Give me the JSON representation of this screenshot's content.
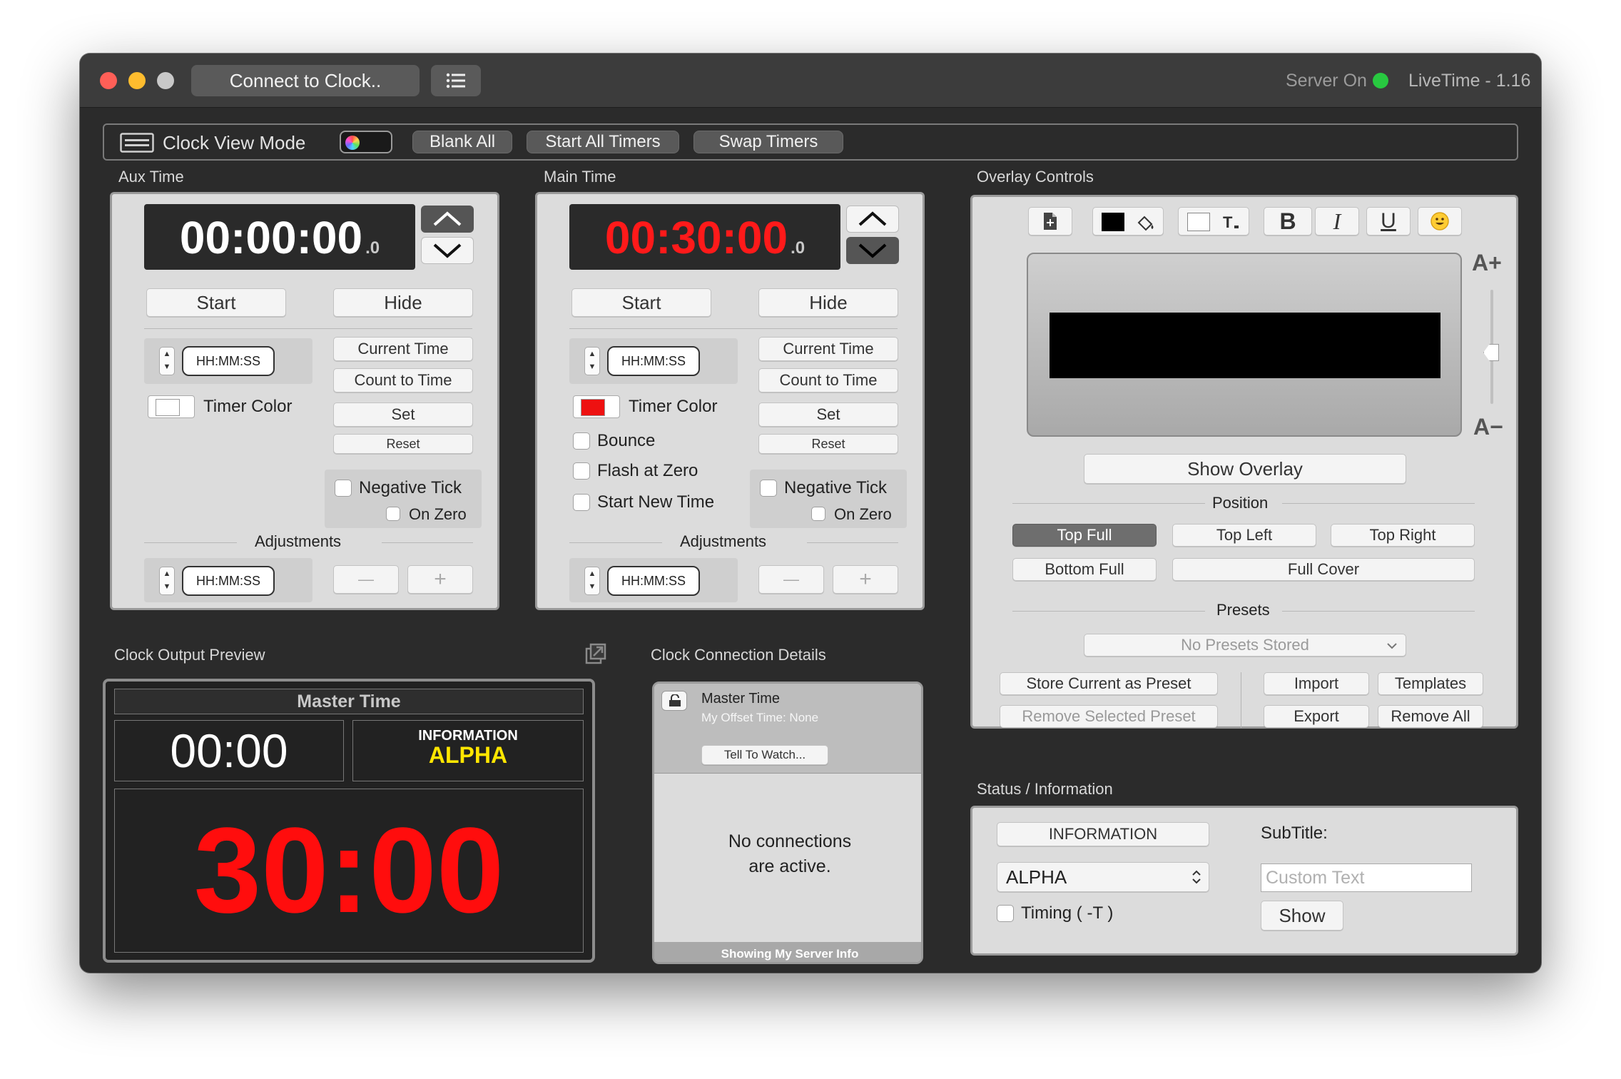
{
  "titlebar": {
    "connect_button": "Connect to Clock..",
    "server_status": "Server On",
    "app_version": "LiveTime - 1.16",
    "server_status_color": "#28c840"
  },
  "toolbar": {
    "clock_view_mode": "Clock View Mode",
    "blank_all": "Blank All",
    "start_all_timers": "Start All Timers",
    "swap_timers": "Swap Timers"
  },
  "aux": {
    "section_label": "Aux Time",
    "time": "00:00:00",
    "tenths": ".0",
    "time_color": "#ffffff",
    "start": "Start",
    "hide": "Hide",
    "hms_placeholder": "HH:MM:SS",
    "current_time": "Current Time",
    "count_to_time": "Count to Time",
    "timer_color_label": "Timer Color",
    "timer_color_swatch": "#ffffff",
    "set": "Set",
    "reset": "Reset",
    "negative_tick": "Negative Tick",
    "on_zero": "On Zero",
    "adjustments": "Adjustments",
    "adj_placeholder": "HH:MM:SS",
    "minus": "—",
    "plus": "+"
  },
  "main": {
    "section_label": "Main Time",
    "time": "00:30:00",
    "tenths": ".0",
    "time_color": "#ff1a1a",
    "start": "Start",
    "hide": "Hide",
    "hms_placeholder": "HH:MM:SS",
    "current_time": "Current Time",
    "count_to_time": "Count to Time",
    "timer_color_label": "Timer Color",
    "timer_color_swatch": "#ee1111",
    "bounce": "Bounce",
    "flash_at_zero": "Flash at Zero",
    "start_new_time": "Start New Time",
    "set": "Set",
    "reset": "Reset",
    "negative_tick": "Negative Tick",
    "on_zero": "On Zero",
    "adjustments": "Adjustments",
    "adj_placeholder": "HH:MM:SS",
    "minus": "—",
    "plus": "+"
  },
  "preview": {
    "section_label": "Clock Output Preview",
    "master_time_label": "Master Time",
    "aux_display": "00:00",
    "info_title": "INFORMATION",
    "info_subtitle": "ALPHA",
    "main_display": "30:00",
    "main_display_color": "#ff0d0d",
    "info_subtitle_color": "#ffe600"
  },
  "connection": {
    "section_label": "Clock Connection Details",
    "master_time": "Master Time",
    "offset": "My Offset Time: None",
    "tell_to_watch": "Tell To Watch...",
    "no_connections_line1": "No connections",
    "no_connections_line2": "are active.",
    "footer": "Showing My Server Info"
  },
  "overlay": {
    "section_label": "Overlay Controls",
    "text_color": "#000000",
    "font_bigger": "A+",
    "font_smaller": "A−",
    "slider_level": 0.45,
    "show_overlay": "Show Overlay",
    "position_label": "Position",
    "positions": {
      "top_full": "Top Full",
      "top_left": "Top Left",
      "top_right": "Top Right",
      "bottom_full": "Bottom Full",
      "full_cover": "Full Cover"
    },
    "presets_label": "Presets",
    "presets_select": "No Presets Stored",
    "store_preset": "Store Current as Preset",
    "remove_preset": "Remove Selected Preset",
    "import": "Import",
    "templates": "Templates",
    "export": "Export",
    "remove_all": "Remove All"
  },
  "status": {
    "section_label": "Status / Information",
    "info_button": "INFORMATION",
    "subtitle_label": "SubTitle:",
    "select_value": "ALPHA",
    "custom_text_placeholder": "Custom Text",
    "timing": "Timing ( -T )",
    "show": "Show"
  }
}
